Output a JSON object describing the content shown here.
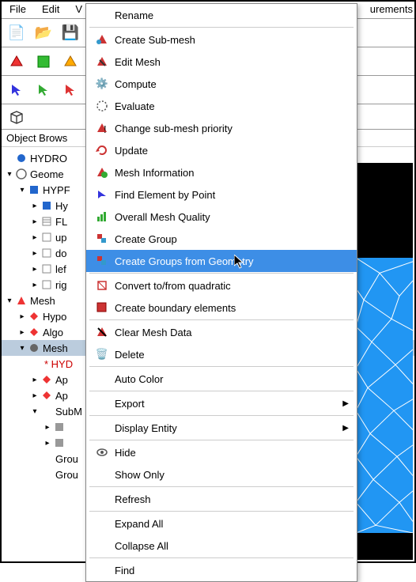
{
  "menubar": {
    "file": "File",
    "edit": "Edit",
    "view": "V"
  },
  "right_partial": "urements",
  "section": "Object Brows",
  "tree": {
    "hydro": "HYDRO",
    "geom": "Geome",
    "hypf": "HYPF",
    "hy": "Hy",
    "fl": "FL",
    "up": "up",
    "do": "do",
    "lef": "lef",
    "rig": "rig",
    "mesh": "Mesh",
    "hypo": "Hypo",
    "algo": "Algo",
    "mesh_sel": "Mesh",
    "hyd_err": "* HYD",
    "ap1": "Ap",
    "ap2": "Ap",
    "subm": "SubM",
    "grou1": "Grou",
    "grou2": "Grou"
  },
  "menu": {
    "rename": "Rename",
    "create_submesh": "Create Sub-mesh",
    "edit_mesh": "Edit Mesh",
    "compute": "Compute",
    "evaluate": "Evaluate",
    "change_submesh": "Change sub-mesh priority",
    "update": "Update",
    "mesh_info": "Mesh Information",
    "find_element": "Find Element by Point",
    "overall_quality": "Overall Mesh Quality",
    "create_group": "Create Group",
    "create_groups_geom": "Create Groups from Geometry",
    "convert_quad": "Convert to/from quadratic",
    "create_boundary": "Create boundary elements",
    "clear_mesh": "Clear Mesh Data",
    "delete": "Delete",
    "auto_color": "Auto Color",
    "export": "Export",
    "display_entity": "Display Entity",
    "hide": "Hide",
    "show_only": "Show Only",
    "refresh": "Refresh",
    "expand_all": "Expand All",
    "collapse_all": "Collapse All",
    "find": "Find"
  }
}
